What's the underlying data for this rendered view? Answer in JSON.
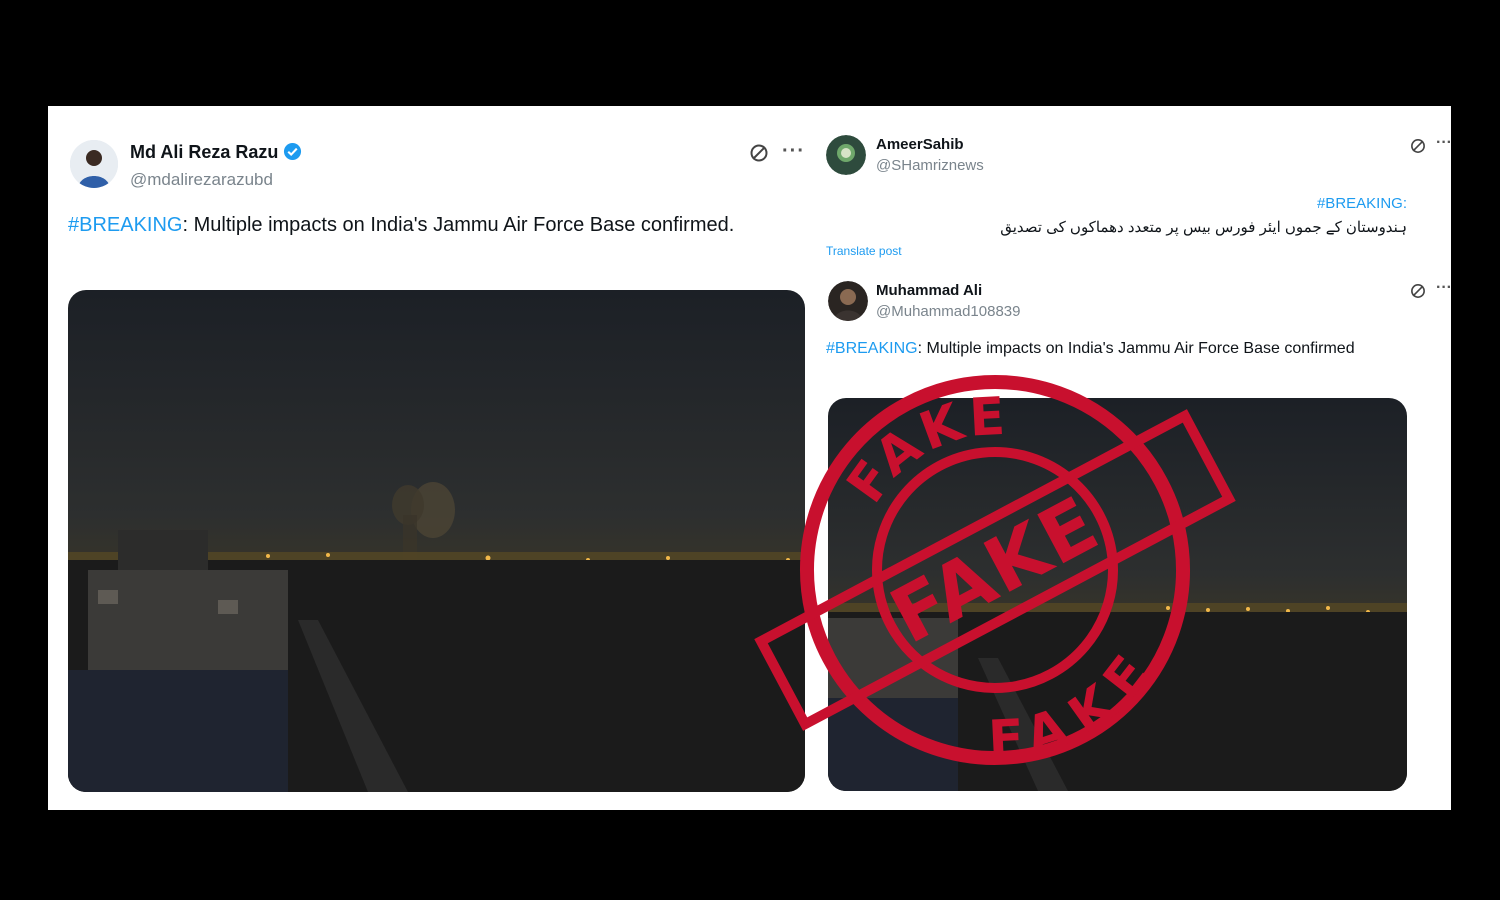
{
  "left_post": {
    "display_name": "Md Ali Reza Razu",
    "handle": "@mdalirezarazubd",
    "hashtag": "#BREAKING",
    "text": ": Multiple impacts on India's Jammu Air Force Base confirmed.",
    "verified": true
  },
  "right_post": {
    "display_name": "AmeerSahib",
    "handle": "@SHamriznews",
    "hashtag": "#BREAKING:",
    "text_urdu": "ہندوستان کے جموں ایئر فورس بیس پر متعدد دھماکوں کی تصدیق",
    "translate_label": "Translate post"
  },
  "quoted_post": {
    "display_name": "Muhammad Ali",
    "handle": "@Muhammad108839",
    "hashtag": "#BREAKING",
    "text": ": Multiple impacts on India's Jammu Air Force Base confirmed"
  },
  "stamp": {
    "top_word": "FAKE",
    "center_word": "FAKE",
    "bottom_word": "FAKE",
    "color": "#c8102e"
  },
  "colors": {
    "hashtag": "#1d9bf0",
    "verified": "#1d9bf0"
  }
}
